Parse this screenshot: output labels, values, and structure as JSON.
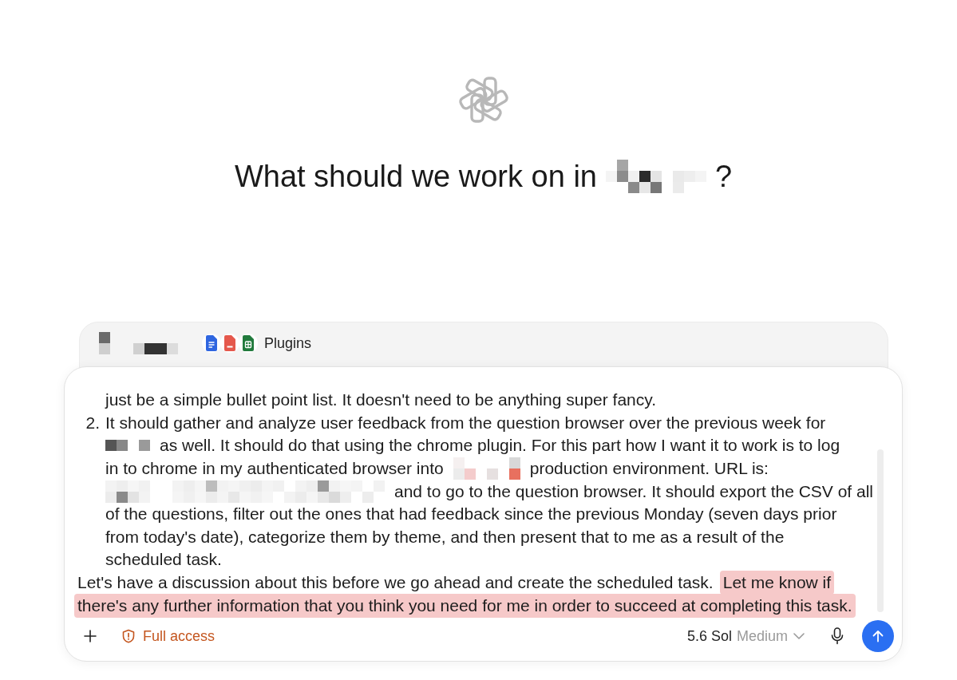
{
  "heading": {
    "parts": [
      {
        "kind": "text",
        "text": "What should we work on in"
      },
      {
        "kind": "redaction"
      },
      {
        "kind": "text",
        "text": "?"
      }
    ]
  },
  "context_bar": {
    "parts": [
      {
        "kind": "redaction"
      },
      {
        "kind": "redaction"
      }
    ],
    "plugins_label": "Plugins"
  },
  "composer": {
    "list_items": [
      {
        "lines": [
          [
            {
              "kind": "text",
              "text": "just be a simple bullet point list. It doesn't need to be anything super fancy.",
              "highlighted": false
            }
          ]
        ]
      },
      {
        "number": "2.",
        "lines": [
          [
            {
              "kind": "text",
              "text": "It should gather and analyze user feedback from the question browser over the previous week for",
              "highlighted": false
            }
          ],
          [
            {
              "kind": "redaction"
            },
            {
              "kind": "text",
              "text": "as well. It should do that using the chrome plugin. For this part how I want it to work is to log",
              "highlighted": false
            }
          ],
          [
            {
              "kind": "text",
              "text": "in to chrome in my authenticated browser into",
              "highlighted": false
            },
            {
              "kind": "redaction"
            },
            {
              "kind": "text",
              "text": "production environment. URL is:",
              "highlighted": false
            }
          ],
          [
            {
              "kind": "redaction"
            },
            {
              "kind": "text",
              "text": "and to go to the question browser. It should export the CSV of all",
              "highlighted": false
            }
          ],
          [
            {
              "kind": "text",
              "text": "of the questions, filter out the ones that had feedback since the previous Monday (seven days prior",
              "highlighted": false
            }
          ],
          [
            {
              "kind": "text",
              "text": "from today's date), categorize them by theme, and then present that to me as a result of the",
              "highlighted": false
            }
          ],
          [
            {
              "kind": "text",
              "text": "scheduled task.",
              "highlighted": false
            }
          ]
        ]
      }
    ],
    "paragraphs": [
      {
        "lines": [
          [
            {
              "kind": "text",
              "text": "Let's have a discussion about this before we go ahead and create the scheduled task.",
              "highlighted": false
            },
            {
              "kind": "text",
              "text": "Let me know if",
              "highlighted": true
            }
          ],
          [
            {
              "kind": "text",
              "text": "there's any further information that you think you need for me in order to succeed at completing this task.",
              "highlighted": true
            }
          ]
        ]
      }
    ],
    "toolbar": {
      "access": {
        "label": "Full access"
      },
      "model": {
        "name": "5.6 Sol",
        "effort": "Medium"
      }
    }
  }
}
